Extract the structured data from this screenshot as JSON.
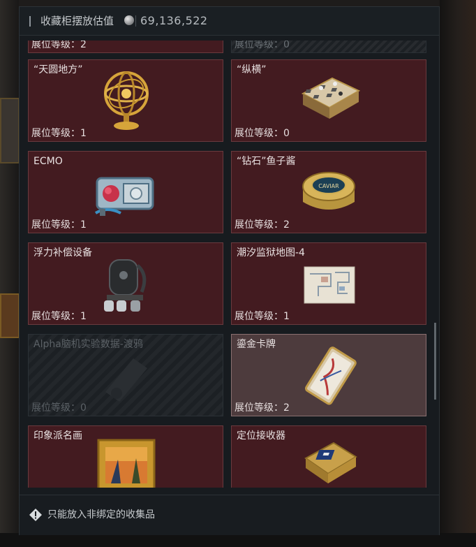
{
  "header": {
    "title": "收藏柜摆放估值",
    "value": "69,136,522",
    "coin_icon": "silver-coin-icon"
  },
  "level_prefix": "展位等级：",
  "cards": [
    {
      "name": "",
      "level_text": "展位等级：2",
      "icon": "unknown-item-icon"
    },
    {
      "name": "",
      "level_text": "展位等级：0",
      "icon": "unknown-item-icon"
    },
    {
      "name": "“天圆地方”",
      "level_text": "展位等级：1",
      "icon": "armillary-sphere-icon"
    },
    {
      "name": "“纵横”",
      "level_text": "展位等级：0",
      "icon": "chessboard-icon"
    },
    {
      "name": "ECMO",
      "level_text": "展位等级：1",
      "icon": "ecmo-machine-icon"
    },
    {
      "name": "“钻石”鱼子酱",
      "level_text": "展位等级：2",
      "icon": "caviar-tin-icon"
    },
    {
      "name": "浮力补偿设备",
      "level_text": "展位等级：1",
      "icon": "buoyancy-device-icon"
    },
    {
      "name": "潮汐监狱地图-4",
      "level_text": "展位等级：1",
      "icon": "map-icon"
    },
    {
      "name": "Alpha脑机实验数据-渡鸦",
      "level_text": "展位等级：0",
      "icon": "data-device-icon"
    },
    {
      "name": "鎏金卡牌",
      "level_text": "展位等级：2",
      "icon": "gilded-card-icon"
    },
    {
      "name": "印象派名画",
      "level_text": "",
      "icon": "painting-icon"
    },
    {
      "name": "定位接收器",
      "level_text": "",
      "icon": "receiver-icon"
    }
  ],
  "footer": {
    "notice": "只能放入非绑定的收集品",
    "icon": "warning-diamond-icon"
  },
  "colors": {
    "card_bg": "#431b20",
    "card_highlight": "#4d3b3d",
    "panel_bg": "#171b1f"
  }
}
